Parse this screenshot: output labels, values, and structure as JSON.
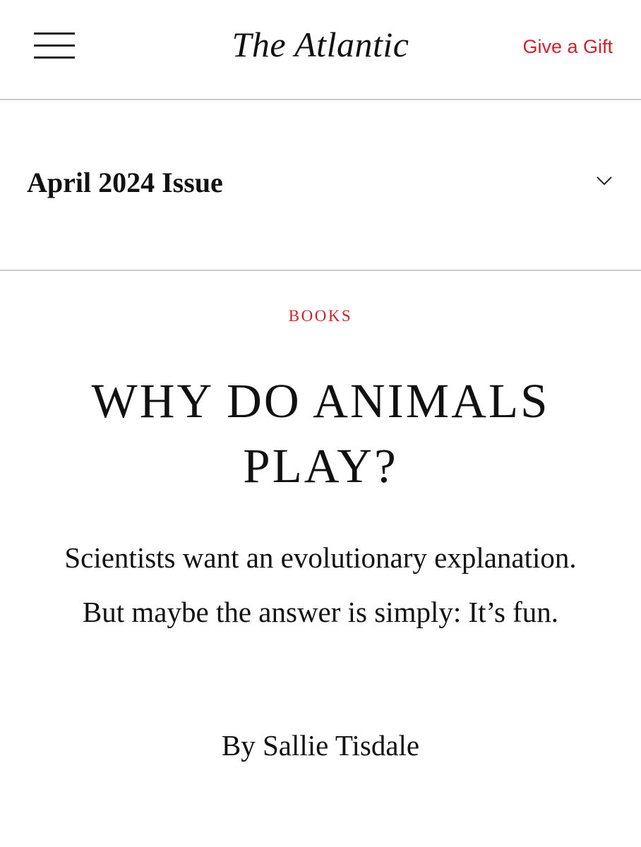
{
  "header": {
    "logo_text": "The Atlantic",
    "gift_link": "Give a Gift",
    "menu_icon": "hamburger-menu-icon"
  },
  "issue_selector": {
    "label": "April 2024 Issue",
    "icon": "chevron-down-icon"
  },
  "article": {
    "section": "BOOKS",
    "headline_line1": "WHY DO ANIMALS",
    "headline_line2": "PLAY?",
    "dek": "Scientists want an evolutionary explanation. But maybe the answer is simply: It’s fun.",
    "byline_prefix": "By",
    "author": "Sallie Tisdale"
  },
  "colors": {
    "accent": "#d0202a",
    "text": "#111111",
    "divider": "#c9c9c9",
    "background": "#ffffff"
  }
}
